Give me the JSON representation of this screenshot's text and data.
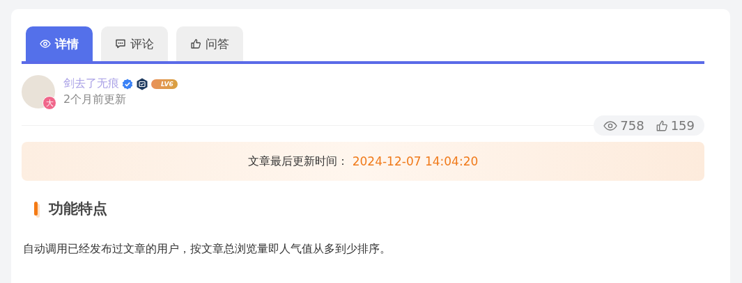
{
  "tabs": [
    {
      "label": "详情",
      "kind": "details",
      "selected": true
    },
    {
      "label": "评论",
      "kind": "comments",
      "selected": false
    },
    {
      "label": "问答",
      "kind": "qa",
      "selected": false
    }
  ],
  "author": {
    "name": "剑去了无痕",
    "verified": true,
    "level": "LV6",
    "avatar_badge": "大",
    "updated": "2个月前更新"
  },
  "stats": {
    "views": "758",
    "likes": "159"
  },
  "update_banner": {
    "label": "文章最后更新时间：",
    "time": "2024-12-07 14:04:20"
  },
  "section": {
    "title": "功能特点",
    "text": "自动调用已经发布过文章的用户，按文章总浏览量即人气值从多到少排序。"
  }
}
